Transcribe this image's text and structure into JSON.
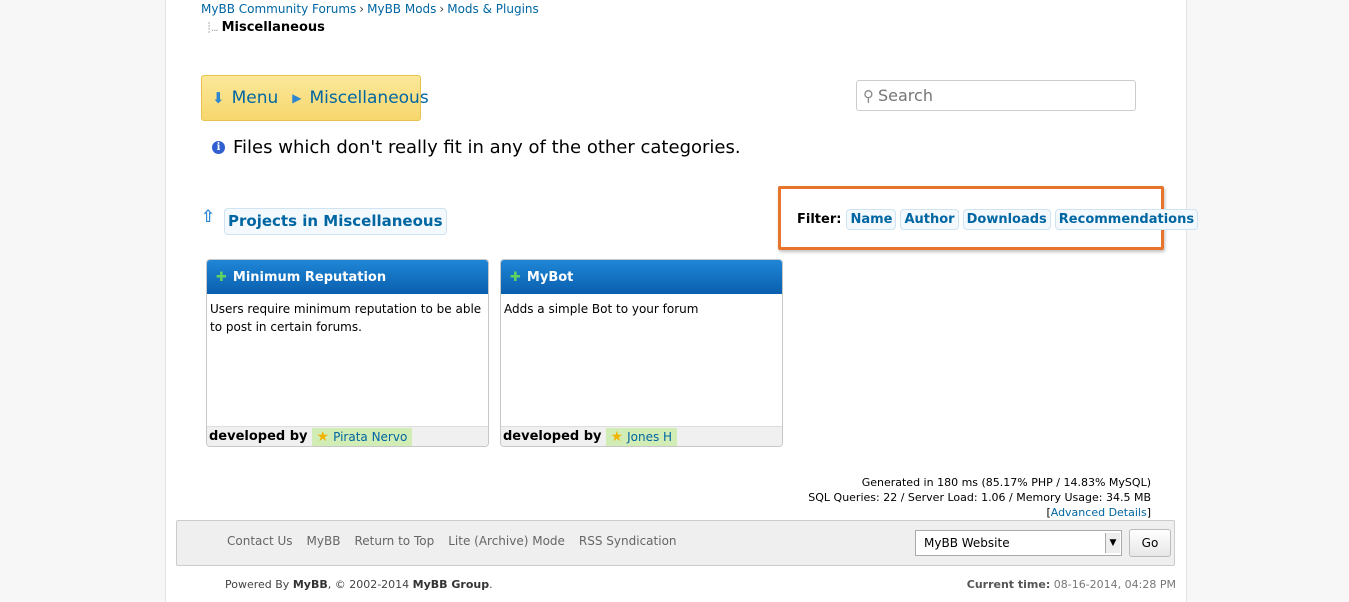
{
  "breadcrumb": {
    "items": [
      "MyBB Community Forums",
      "MyBB Mods",
      "Mods & Plugins"
    ],
    "separator": "›",
    "active": "Miscellaneous"
  },
  "menu": {
    "menu_label": "Menu",
    "current_label": "Miscellaneous"
  },
  "search": {
    "placeholder": "Search"
  },
  "category": {
    "description": "Files which don't really fit in any of the other categories."
  },
  "projects": {
    "heading": "Projects in Miscellaneous"
  },
  "filter": {
    "label": "Filter:",
    "options": [
      "Name",
      "Author",
      "Downloads",
      "Recommendations"
    ]
  },
  "cards": [
    {
      "title": "Minimum Reputation",
      "description": "Users require minimum reputation to be able to post in certain forums.",
      "developed_by_label": "developed by",
      "developer": "Pirata Nervo"
    },
    {
      "title": "MyBot",
      "description": "Adds a simple Bot to your forum",
      "developed_by_label": "developed by",
      "developer": "Jones H"
    }
  ],
  "stats": {
    "line1": "Generated in 180 ms (85.17% PHP / 14.83% MySQL)",
    "line2": "SQL Queries: 22 / Server Load: 1.06 / Memory Usage: 34.5 MB",
    "advanced_link": "Advanced Details"
  },
  "footer": {
    "links": [
      "Contact Us",
      "MyBB",
      "Return to Top",
      "Lite (Archive) Mode",
      "RSS Syndication"
    ],
    "theme_selected": "MyBB Website",
    "go_label": "Go",
    "powered_prefix": "Powered By",
    "powered_mybb": "MyBB",
    "copyright_mid": ", © 2002-2014",
    "powered_group": "MyBB Group",
    "copyright_end": ".",
    "current_time_label": "Current time:",
    "current_time_value": "08-16-2014, 04:28 PM"
  },
  "colors": {
    "link": "#0066a2",
    "card_header": "#0a5fae",
    "highlight_border": "#e8732b",
    "menu_bg": "#f7d76d",
    "developer_bg": "#d2ecb6"
  }
}
